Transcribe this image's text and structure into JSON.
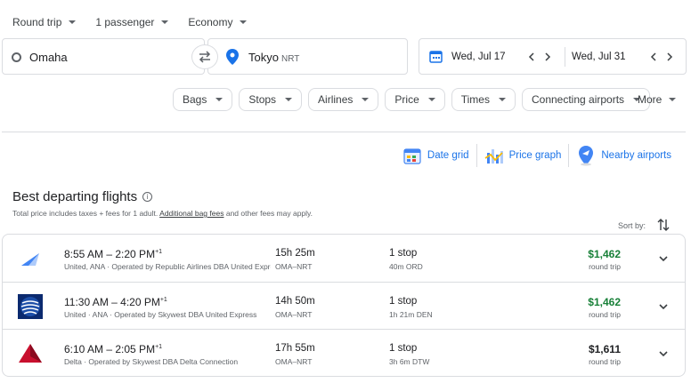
{
  "search": {
    "trip_type": "Round trip",
    "passengers": "1 passenger",
    "cabin": "Economy",
    "origin": "Omaha",
    "destination": "Tokyo",
    "destination_code": "NRT",
    "depart_date": "Wed, Jul 17",
    "return_date": "Wed, Jul 31"
  },
  "filters": [
    "Bags",
    "Stops",
    "Airlines",
    "Price",
    "Times",
    "Connecting airports"
  ],
  "more_label": "More",
  "tools": {
    "date_grid": "Date grid",
    "price_graph": "Price graph",
    "nearby_airports": "Nearby airports"
  },
  "results": {
    "title": "Best departing flights",
    "note_pre": "Total price includes taxes + fees for 1 adult.",
    "note_link": "Additional bag fees",
    "note_post": "and other fees may apply.",
    "sort_label": "Sort by:"
  },
  "flights": [
    {
      "time": "8:55 AM – 2:20 PM",
      "plus_days": "+1",
      "airline": "United, ANA · Operated by Republic Airlines DBA United Express",
      "duration": "15h 25m",
      "route": "OMA–NRT",
      "stops": "1 stop",
      "layover": "40m ORD",
      "price": "$1,462",
      "price_type": "round trip",
      "price_color": "#188038"
    },
    {
      "time": "11:30 AM – 4:20 PM",
      "plus_days": "+1",
      "airline": "United · ANA · Operated by Skywest DBA United Express",
      "duration": "14h 50m",
      "route": "OMA–NRT",
      "stops": "1 stop",
      "layover": "1h 21m DEN",
      "price": "$1,462",
      "price_type": "round trip",
      "price_color": "#188038"
    },
    {
      "time": "6:10 AM – 2:05 PM",
      "plus_days": "+1",
      "airline": "Delta · Operated by Skywest DBA Delta Connection",
      "duration": "17h 55m",
      "route": "OMA–NRT",
      "stops": "1 stop",
      "layover": "3h 6m DTW",
      "price": "$1,611",
      "price_type": "round trip",
      "price_color": "#202124"
    }
  ]
}
